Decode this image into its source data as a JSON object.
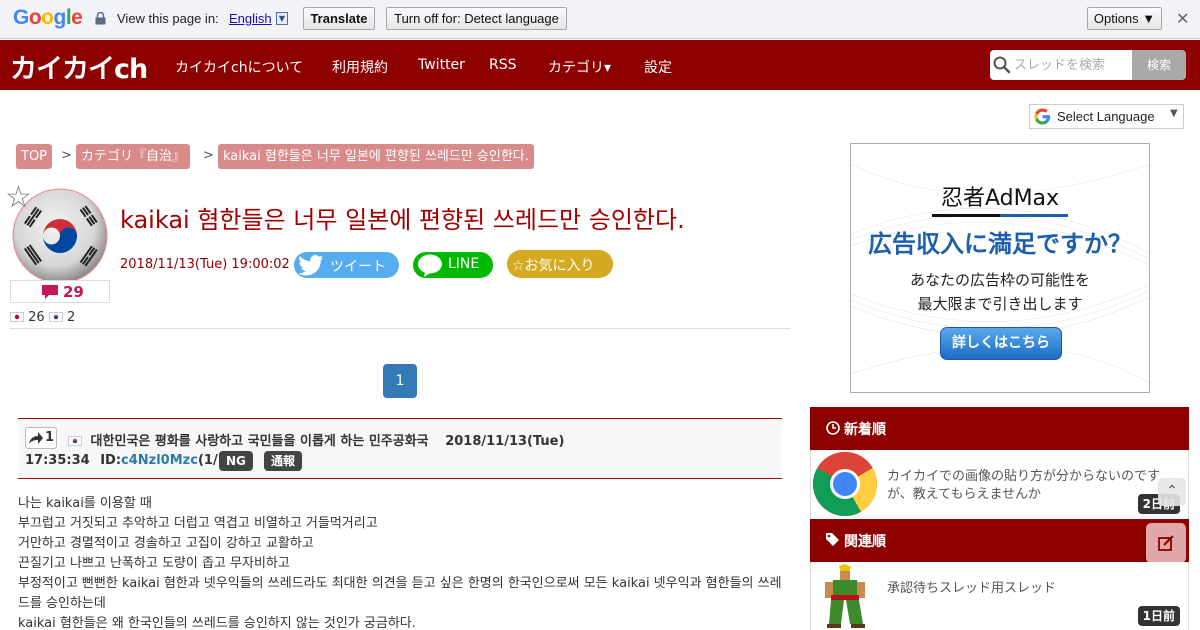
{
  "translate_bar": {
    "logo": [
      "G",
      "o",
      "o",
      "g",
      "l",
      "e"
    ],
    "view_text": "View this page in:",
    "language": "English",
    "translate_label": "Translate",
    "turn_off_label": "Turn off for: Detect language",
    "options_label": "Options ▼",
    "close_glyph": "✕"
  },
  "header": {
    "logo": "カイカイch",
    "nav": [
      "カイカイchについて",
      "利用規約",
      "Twitter",
      "RSS",
      "カテゴリ▾",
      "設定"
    ],
    "search_placeholder": "スレッドを検索",
    "search_button": "検索"
  },
  "select_language": {
    "label": "Select Language",
    "caret": "▼"
  },
  "breadcrumb": [
    "TOP",
    "カテゴリ『自治』",
    "kaikai 혐한들은 너무 일본에 편향된 쓰레드만 승인한다."
  ],
  "breadcrumb_sep": ">",
  "thread": {
    "title": "kaikai 혐한들은 너무 일본에 편향된 쓰레드만 승인한다.",
    "date": "2018/11/13(Tue) 19:00:02",
    "reply_count": "29",
    "jp_count": "26",
    "kr_count": "2",
    "tweet_label": "ツイート",
    "line_label": "LINE",
    "favorite_label": "☆お気に入り",
    "fav_star": "☆"
  },
  "pagination": {
    "current": "1"
  },
  "post": {
    "number": "1",
    "name": "대한민국은 평화를 사랑하고 국민들을 이롭게 하는 민주공화국",
    "date": "2018/11/13(Tue)",
    "time": "17:35:34",
    "id_prefix": "ID:",
    "id": "c4Nzl0Mzc",
    "id_count": "(1/1)",
    "ng_label": "NG",
    "report_label": "通報",
    "body": [
      "나는 kaikai를 이용할 때",
      "부끄럽고 거짓되고 추악하고 더럽고 역겹고 비열하고 거들먹거리고",
      "거만하고 경멸적이고 경솔하고 고집이 강하고 교활하고",
      "끈질기고 나쁘고 난폭하고 도량이 좁고 무자비하고",
      "부정적이고 뻔뻔한 kaikai 혐한과 넷우익들의 쓰레드라도 최대한 의견을 듣고 싶은 한명의 한국인으로써 모든 kaikai 넷우익과 혐한들의 쓰레드를 승인하는데",
      "kaikai 혐한들은 왜 한국인들의 쓰레드를 승인하지 않는 것인가 궁금하다."
    ]
  },
  "ad": {
    "logo": "忍者AdMax",
    "headline": "広告収入に満足ですか？",
    "sub1": "あなたの広告枠の可能性を",
    "sub2": "最大限まで引き出します",
    "button": "詳しくはこちら"
  },
  "sidebar": {
    "new_heading": "新着順",
    "related_heading": "関連順",
    "new_items": [
      {
        "text": "カイカイでの画像の貼り方が分からないのですが、教えてもらえませんか",
        "age": "2日前",
        "thumb": "chrome-icon"
      }
    ],
    "related_items": [
      {
        "text": "承認待ちスレッド用スレッド",
        "age": "1日前",
        "thumb": "fighter-image"
      }
    ],
    "back_to_top": "⌃"
  },
  "colors": {
    "brand": "#8d0000",
    "title": "#a00000",
    "crumb": "#d98a8a",
    "twitter": "#55acee",
    "line": "#00b900",
    "favorite": "#d4aa22",
    "pagination": "#337ab7"
  }
}
